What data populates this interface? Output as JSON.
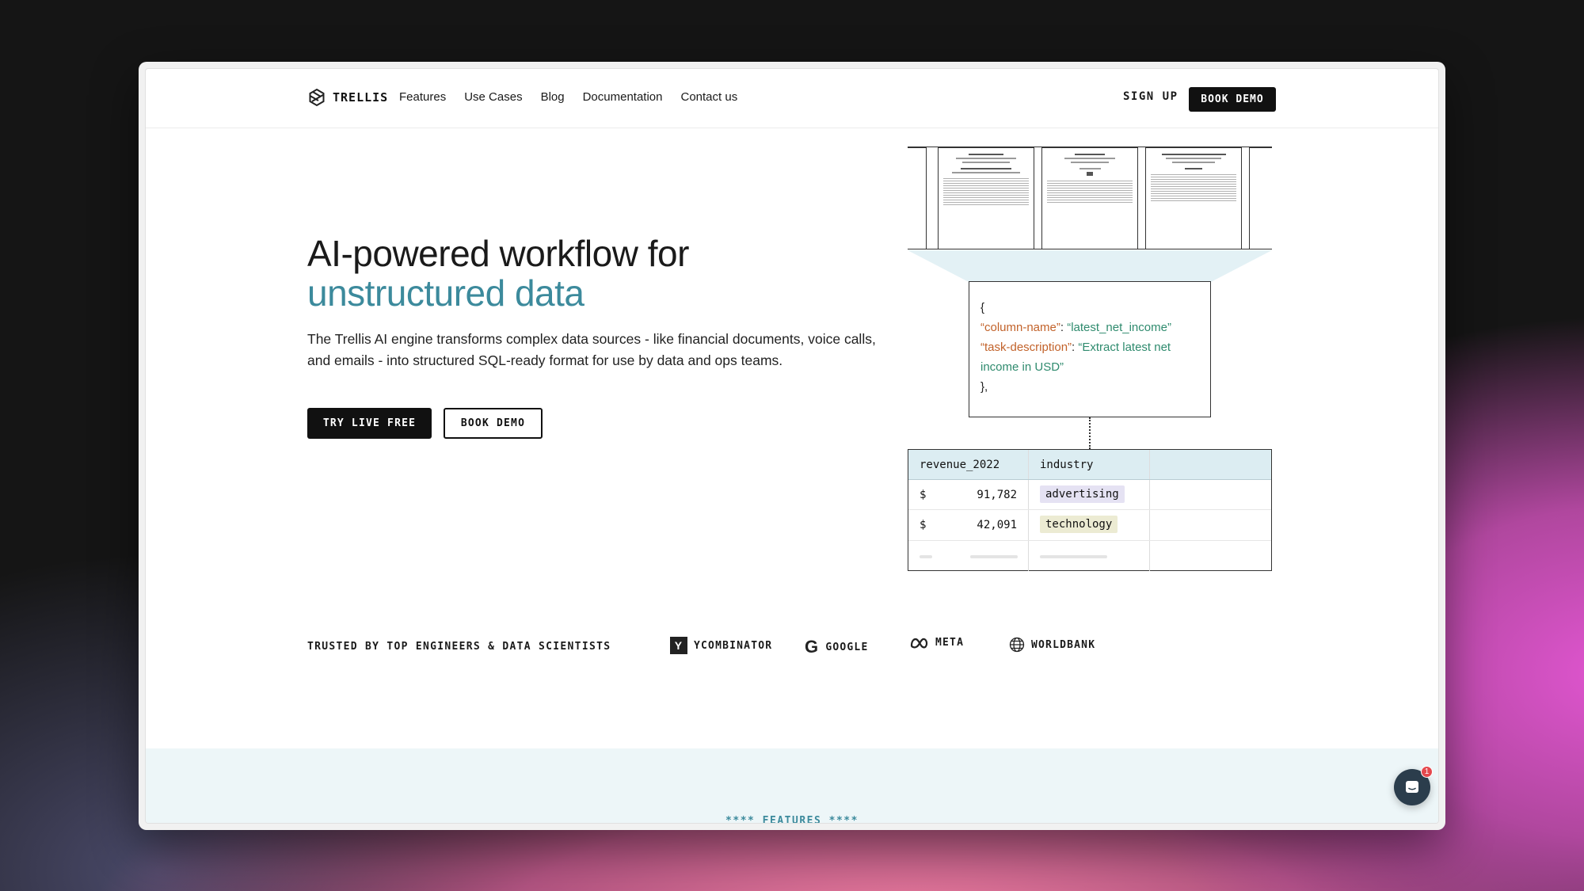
{
  "nav": {
    "brand": "TRELLIS",
    "links": [
      "Features",
      "Use Cases",
      "Blog",
      "Documentation",
      "Contact us"
    ],
    "sign_up": "SIGN UP",
    "book_demo": "BOOK DEMO"
  },
  "hero": {
    "title_line1": "AI-powered workflow for",
    "title_line2": "unstructured data",
    "description": "The Trellis AI engine transforms complex data sources - like financial documents, voice calls, and emails - into structured SQL-ready format for use by data and ops teams.",
    "cta_primary": "TRY LIVE FREE",
    "cta_secondary": "BOOK DEMO"
  },
  "illustration": {
    "json_open": "{",
    "key1": "“column-name”",
    "sep1": ": ",
    "val1": "“latest_net_income”",
    "key2": "“task-description”",
    "sep2": ": ",
    "val2": "“Extract latest net income in USD”",
    "json_close": "},",
    "table": {
      "headers": [
        "revenue_2022",
        "industry"
      ],
      "rows": [
        {
          "currency": "$",
          "value": "91,782",
          "industry": "advertising"
        },
        {
          "currency": "$",
          "value": "42,091",
          "industry": "technology"
        }
      ]
    }
  },
  "trusted": {
    "label": "TRUSTED BY TOP ENGINEERS & DATA SCIENTISTS",
    "logos": [
      {
        "mark": "Y",
        "name": "YCOMBINATOR",
        "icon": "ycombinator-icon"
      },
      {
        "mark": "G",
        "name": "GOOGLE",
        "icon": "google-icon"
      },
      {
        "name": "META",
        "icon": "meta-icon"
      },
      {
        "name": "WORLDBANK",
        "icon": "globe-icon"
      }
    ]
  },
  "features": {
    "label": "**** FEATURES ****"
  },
  "chat": {
    "badge_count": "1",
    "icon": "chat-icon"
  },
  "colors": {
    "accent_teal": "#3c8a9c",
    "json_key": "#c2622a",
    "json_value": "#2f8b6e",
    "table_header": "#dcedf2",
    "tag_advertising": "#e5e2f3",
    "tag_technology": "#ecebd3",
    "chat_bubble": "#2b3d4c",
    "badge": "#e5484d"
  }
}
